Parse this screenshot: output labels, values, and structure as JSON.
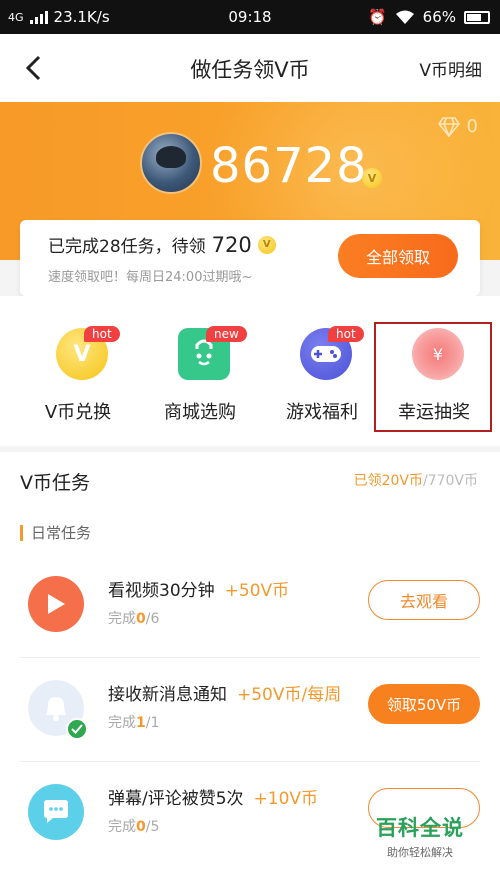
{
  "status_bar": {
    "network": "4G",
    "speed": "23.1K/s",
    "time": "09:18",
    "battery": "66%"
  },
  "nav": {
    "title": "做任务领V币",
    "right_link": "V币明细"
  },
  "header": {
    "diamond_count": "0",
    "coin_total": "86728"
  },
  "summary_card": {
    "text": "已完成28任务，待领",
    "pending_amount": "720",
    "subtext": "速度领取吧！每周日24:00过期哦~",
    "claim_all_label": "全部领取"
  },
  "quick_actions": [
    {
      "label": "V币兑换",
      "badge": "hot",
      "icon": "v-coin-icon"
    },
    {
      "label": "商城选购",
      "badge": "new",
      "icon": "shopping-bag-icon"
    },
    {
      "label": "游戏福利",
      "badge": "hot",
      "icon": "gamepad-icon"
    },
    {
      "label": "幸运抽奖",
      "badge": "",
      "icon": "lucky-draw-icon"
    }
  ],
  "tasks": {
    "title": "V币任务",
    "claimed": "已领20V币",
    "total": "/770V币",
    "section_label": "日常任务",
    "items": [
      {
        "name": "看视频30分钟",
        "reward": "+50V币",
        "progress_prefix": "完成",
        "done": "0",
        "target": "/6",
        "button": "去观看",
        "icon": "play-icon"
      },
      {
        "name": "接收新消息通知",
        "reward": "+50V币/每周",
        "progress_prefix": "完成",
        "done": "1",
        "target": "/1",
        "button": "领取50V币",
        "icon": "bell-icon"
      },
      {
        "name": "弹幕/评论被赞5次",
        "reward": "+10V币",
        "progress_prefix": "完成",
        "done": "0",
        "target": "/5",
        "button": "",
        "icon": "comment-icon"
      }
    ]
  },
  "watermark": {
    "main": "百科全说",
    "sub": "助你轻松解决"
  },
  "colors": {
    "accent": "#f39a2e",
    "hero_orange": "#f79a28",
    "button_orange": "#f8811f"
  }
}
